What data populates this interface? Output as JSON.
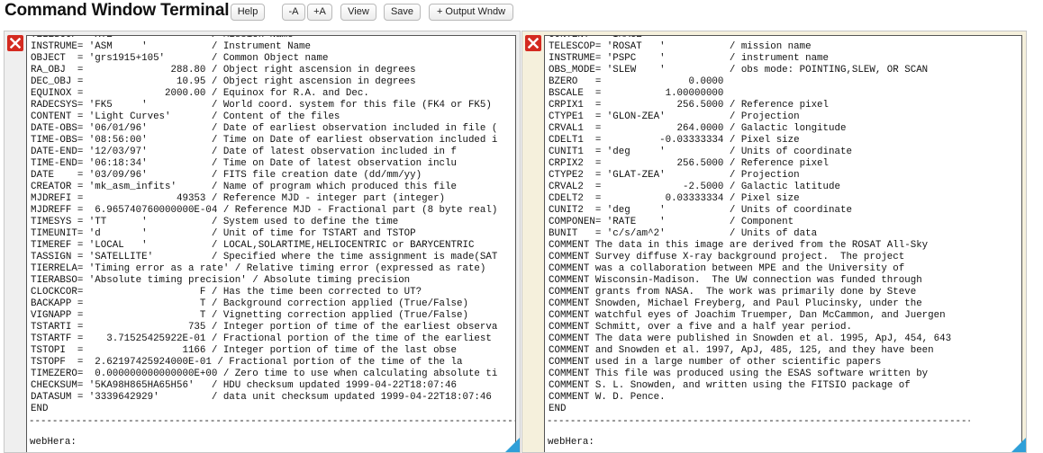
{
  "app": {
    "title": "Command Window Terminal"
  },
  "toolbar": {
    "help_label": "Help",
    "minus_a_label": "-A",
    "plus_a_label": "+A",
    "view_label": "View",
    "save_label": "Save",
    "output_label": "+ Output Wndw"
  },
  "colors": {
    "close_button": "#d42a20",
    "resize_grip": "#2f9fd8",
    "pane_bg": "#efefef",
    "right_pane_bg": "#f5f0dc"
  },
  "left_pane": {
    "lines": "TELESCOP= 'XTE     '           / Mission Name\nINSTRUME= 'ASM     '           / Instrument Name\nOBJECT  = 'grs1915+105'        / Common Object name\nRA_OBJ  =               288.80 / Object right ascension in degrees\nDEC_OBJ =                10.95 / Object right ascension in degrees\nEQUINOX =              2000.00 / Equinox for R.A. and Dec.\nRADECSYS= 'FK5     '           / World coord. system for this file (FK4 or FK5)\nCONTENT = 'Light Curves'       / Content of the files\nDATE-OBS= '06/01/96'           / Date of earliest observation included in file (\nTIME-OBS= '08:56:00'           / Time on Date of earliest observation included i\nDATE-END= '12/03/97'           / Date of latest observation included in f\nTIME-END= '06:18:34'           / Time on Date of latest observation inclu\nDATE    = '03/09/96'           / FITS file creation date (dd/mm/yy)\nCREATOR = 'mk_asm_infits'      / Name of program which produced this file\nMJDREFI =                49353 / Reference MJD - integer part (integer)\nMJDREFF =  6.965740760000000E-04 / Reference MJD - Fractional part (8 byte real)\nTIMESYS = 'TT      '           / System used to define the time\nTIMEUNIT= 'd       '           / Unit of time for TSTART and TSTOP\nTIMEREF = 'LOCAL   '           / LOCAL,SOLARTIME,HELIOCENTRIC or BARYCENTRIC\nTASSIGN = 'SATELLITE'          / Specified where the time assignment is made(SAT\nTIERRELA= 'Timing error as a rate' / Relative timing error (expressed as rate)\nTIERABSO= 'Absolute timing precision' / Absolute timing precision\nCLOCKCOR=                    F / Has the time been corrected to UT?\nBACKAPP =                    T / Background correction applied (True/False)\nVIGNAPP =                    T / Vignetting correction applied (True/False)\nTSTARTI =                  735 / Integer portion of time of the earliest observa\nTSTARTF =    3.71525425922E-01 / Fractional portion of the time of the earliest\nTSTOPI  =                 1166 / Integer portion of time of the last obse\nTSTOPF  =  2.62197425924000E-01 / Fractional portion of the time of the la\nTIMEZERO=  0.000000000000000E+00 / Zero time to use when calculating absolute ti\nCHECKSUM= '5KA98H865HA65H56'   / HDU checksum updated 1999-04-22T18:07:46\nDATASUM = '3339642929'         / data unit checksum updated 1999-04-22T18:07:46\nEND",
    "separator": "---------------------------------------------------------------------------------------------",
    "prompt": "webHera:"
  },
  "right_pane": {
    "lines": "CONTENT = 'IMAGE   '\nTELESCOP= 'ROSAT   '           / mission name\nINSTRUME= 'PSPC    '           / instrument name\nOBS_MODE= 'SLEW    '           / obs mode: POINTING,SLEW, OR SCAN\nBZERO   =               0.0000\nBSCALE  =           1.00000000\nCRPIX1  =             256.5000 / Reference pixel\nCTYPE1  = 'GLON-ZEA'           / Projection\nCRVAL1  =             264.0000 / Galactic longitude\nCDELT1  =          -0.03333334 / Pixel size\nCUNIT1  = 'deg     '           / Units of coordinate\nCRPIX2  =             256.5000 / Reference pixel\nCTYPE2  = 'GLAT-ZEA'           / Projection\nCRVAL2  =              -2.5000 / Galactic latitude\nCDELT2  =           0.03333334 / Pixel size\nCUNIT2  = 'deg     '           / Units of coordinate\nCOMPONEN= 'RATE    '           / Component\nBUNIT   = 'c/s/am^2'           / Units of data\nCOMMENT The data in this image are derived from the ROSAT All-Sky\nCOMMENT Survey diffuse X-ray background project.  The project\nCOMMENT was a collaboration between MPE and the University of\nCOMMENT Wisconsin-Madison.  The UW connection was funded through\nCOMMENT grants from NASA.  The work was primarily done by Steve\nCOMMENT Snowden, Michael Freyberg, and Paul Plucinsky, under the\nCOMMENT watchful eyes of Joachim Truemper, Dan McCammon, and Juergen\nCOMMENT Schmitt, over a five and a half year period.\nCOMMENT The data were published in Snowden et al. 1995, ApJ, 454, 643\nCOMMENT and Snowden et al. 1997, ApJ, 485, 125, and they have been\nCOMMENT used in a large number of other scientific papers\nCOMMENT This file was produced using the ESAS software written by\nCOMMENT S. L. Snowden, and written using the FITSIO package of\nCOMMENT W. D. Pence.\nEND",
    "separator": "---------------------------------------------------------------------------------------------",
    "prompt": "webHera:"
  }
}
